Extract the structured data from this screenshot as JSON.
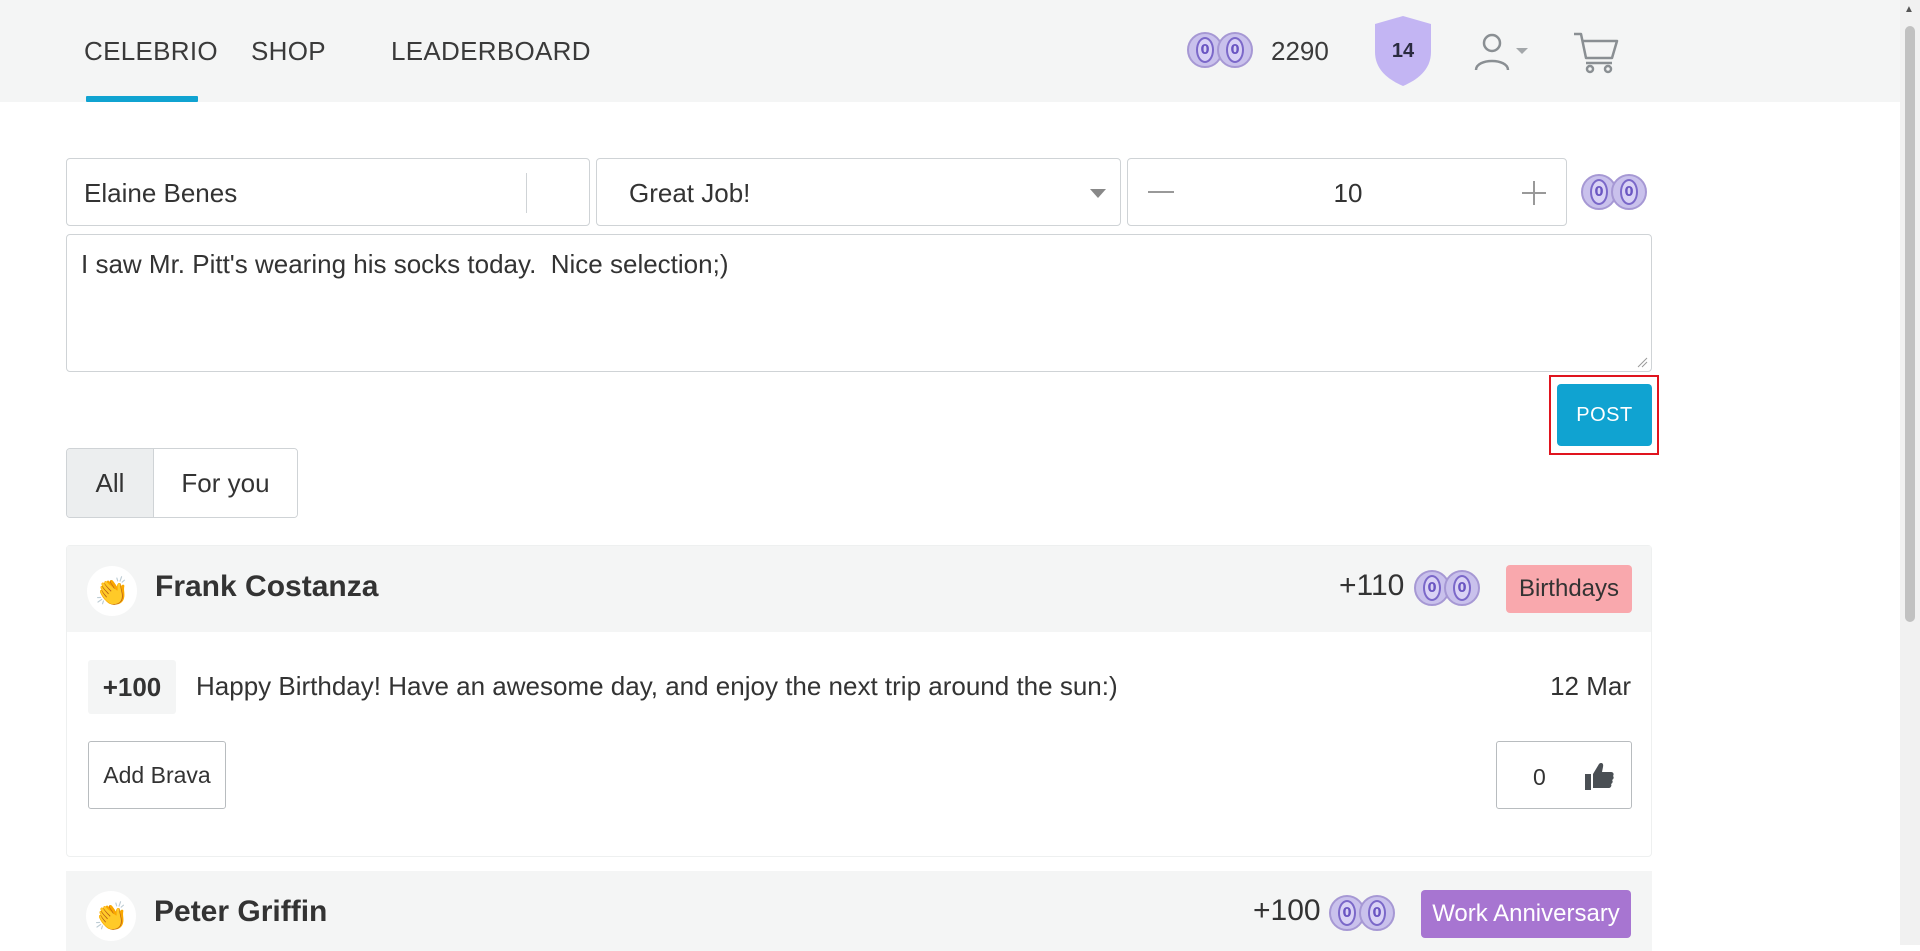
{
  "nav": {
    "brand": "CELEBRIO",
    "shop": "SHOP",
    "leaderboard": "LEADERBOARD",
    "coin_balance": "2290",
    "level": "14",
    "accent_color": "#10a3d1"
  },
  "compose": {
    "recipient": "Elaine Benes",
    "type": "Great Job!",
    "amount": "10",
    "message": "I saw Mr. Pitt's wearing his socks today.  Nice selection;)",
    "post_label": "POST"
  },
  "filters": {
    "all": "All",
    "for_you": "For you"
  },
  "feed": [
    {
      "name": "Frank Costanza",
      "points": "+110",
      "category": "Birthdays",
      "category_color": "#f9a8ad",
      "entry_amount": "+100",
      "entry_message": "Happy Birthday! Have an awesome day, and enjoy the next trip around the sun:)",
      "date": "12 Mar",
      "add_label": "Add Brava",
      "likes": "0"
    },
    {
      "name": "Peter Griffin",
      "points": "+100",
      "category": "Work Anniversary",
      "category_color": "#a775d1"
    }
  ],
  "icons": {
    "coin": "coin-icon",
    "shield": "level-shield-icon",
    "user": "user-icon",
    "cart": "cart-icon",
    "clap": "clapping-hands-icon",
    "thumb": "thumbs-up-icon"
  }
}
